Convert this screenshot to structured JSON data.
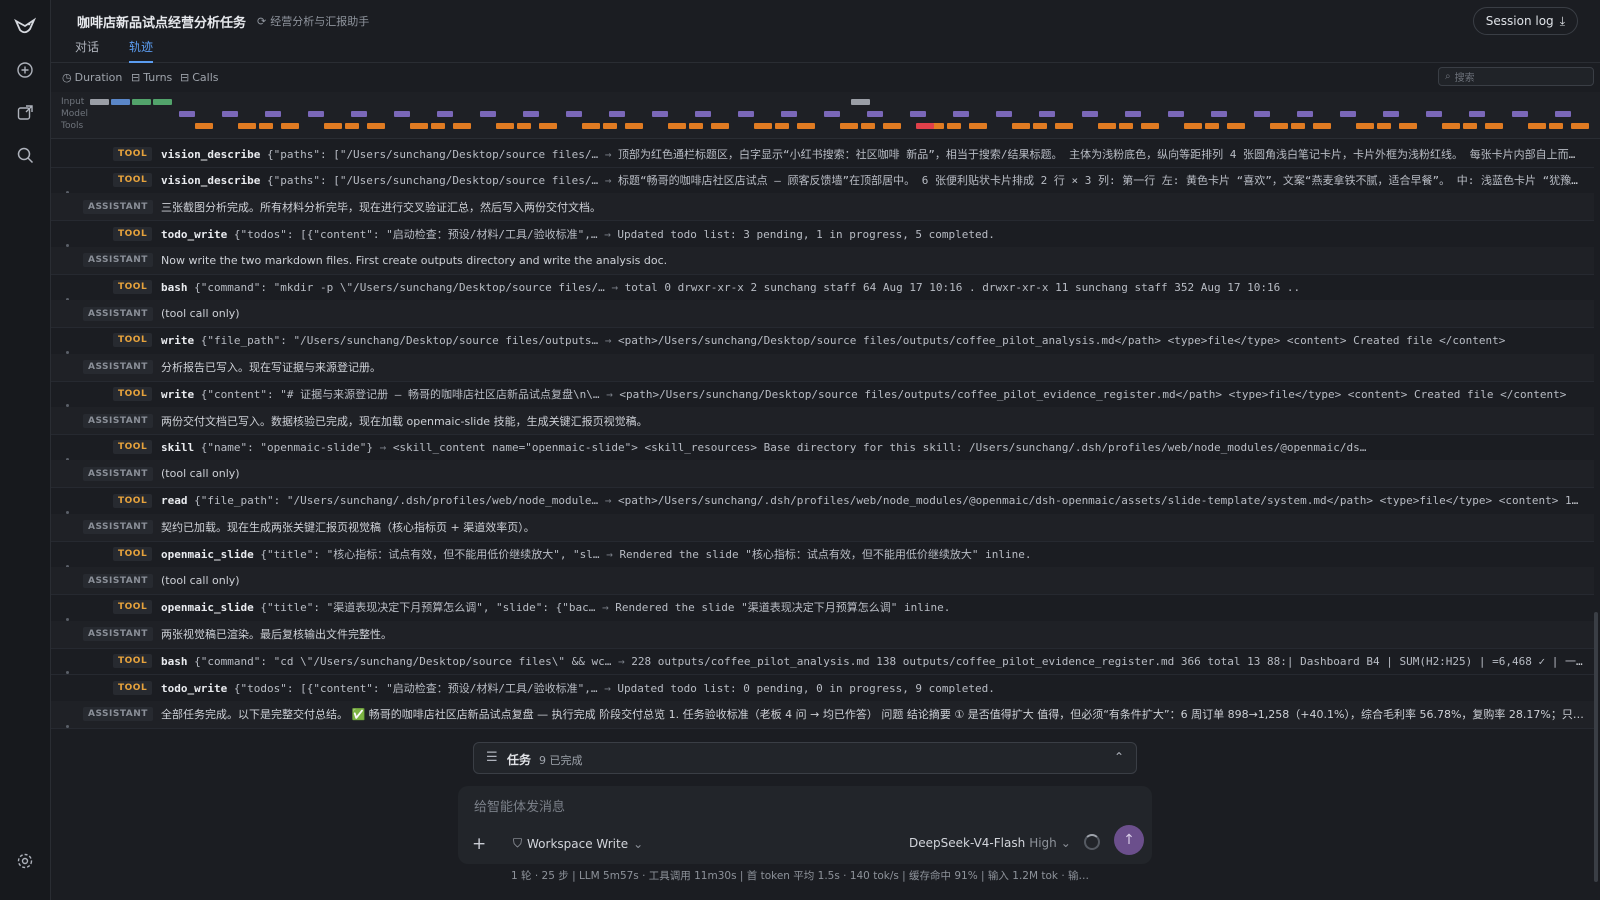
{
  "header": {
    "title": "咖啡店新品试点经营分析任务",
    "subtitle": "经营分析与汇报助手",
    "tabs": [
      {
        "label": "对话",
        "active": false
      },
      {
        "label": "轨迹",
        "active": true
      }
    ],
    "session_button": "Session log"
  },
  "filters": {
    "items": [
      "Duration",
      "Turns",
      "Calls"
    ],
    "search_placeholder": "搜索"
  },
  "timeline": {
    "labels": [
      "Input",
      "Model",
      "Tools"
    ],
    "colors": {
      "input_gray": "#9a9ea6",
      "input_blue": "#5a86c8",
      "input_green": "#52a36b",
      "model": "#7a67b8",
      "tool": "#e07b22",
      "tool_alert": "#e0404a"
    }
  },
  "rows": [
    {
      "kind": "TOOL",
      "tool": "vision_describe",
      "args": "{\"paths\": [\"/Users/sunchang/Desktop/source files/…",
      "result": "顶部为红色通栏标题区，白字显示“小红书搜索：社区咖啡 新品”，相当于搜索/结果标题。 主体为浅粉底色，纵向等距排列 4 张圆角浅白笔记卡片，卡片外框为浅粉红线。 每张卡片内部自上而下…"
    },
    {
      "kind": "TOOL",
      "tool": "vision_describe",
      "args": "{\"paths\": [\"/Users/sunchang/Desktop/source files/…",
      "result": "标题“畅哥的咖啡店社区店试点 – 顾客反馈墙”在顶部居中。 6 张便利贴状卡片排成 2 行 × 3 列: 第一行 左: 黄色卡片 “喜欢”，文案“燕麦拿铁不腻，适合早餐”。 中: 浅蓝色卡片 “犹豫”…"
    },
    {
      "kind": "ASSISTANT",
      "text": "三张截图分析完成。所有材料分析完毕，现在进行交叉验证汇总，然后写入两份交付文档。"
    },
    {
      "kind": "TOOL",
      "tool": "todo_write",
      "args": "{\"todos\": [{\"content\": \"启动检查：预设/材料/工具/验收标准\",…",
      "result": "Updated todo list: 3 pending, 1 in progress, 5 completed."
    },
    {
      "kind": "ASSISTANT",
      "text": "Now write the two markdown files. First create outputs directory and write the analysis doc."
    },
    {
      "kind": "TOOL",
      "tool": "bash",
      "args": "{\"command\": \"mkdir -p \\\"/Users/sunchang/Desktop/source files/…",
      "result": "total 0 drwxr-xr-x 2 sunchang staff 64 Aug 17 10:16 . drwxr-xr-x 11 sunchang staff 352 Aug 17 10:16 .."
    },
    {
      "kind": "ASSISTANT",
      "text": "(tool call only)"
    },
    {
      "kind": "TOOL",
      "tool": "write",
      "args": "{\"file_path\": \"/Users/sunchang/Desktop/source files/outputs…",
      "result": "<path>/Users/sunchang/Desktop/source files/outputs/coffee_pilot_analysis.md</path> <type>file</type> <content> Created file </content>"
    },
    {
      "kind": "ASSISTANT",
      "text": "分析报告已写入。现在写证据与来源登记册。"
    },
    {
      "kind": "TOOL",
      "tool": "write",
      "args": "{\"content\": \"# 证据与来源登记册 — 畅哥的咖啡店社区店新品试点复盘\\n\\…",
      "result": "<path>/Users/sunchang/Desktop/source files/outputs/coffee_pilot_evidence_register.md</path> <type>file</type> <content> Created file </content>"
    },
    {
      "kind": "ASSISTANT",
      "text": "两份交付文档已写入。数据核验已完成，现在加载 openmaic-slide 技能，生成关键汇报页视觉稿。"
    },
    {
      "kind": "TOOL",
      "tool": "skill",
      "args": "{\"name\": \"openmaic-slide\"}",
      "result": "<skill_content name=\"openmaic-slide\"> <skill_resources> Base directory for this skill: /Users/sunchang/.dsh/profiles/web/node_modules/@openmaic/ds…"
    },
    {
      "kind": "ASSISTANT",
      "text": "(tool call only)"
    },
    {
      "kind": "TOOL",
      "tool": "read",
      "args": "{\"file_path\": \"/Users/sunchang/.dsh/profiles/web/node_module…",
      "result": "<path>/Users/sunchang/.dsh/profiles/web/node_modules/@openmaic/dsh-openmaic/assets/slide-template/system.md</path> <type>file</type> <content> 1: …"
    },
    {
      "kind": "ASSISTANT",
      "text": "契约已加载。现在生成两张关键汇报页视觉稿（核心指标页 + 渠道效率页）。"
    },
    {
      "kind": "TOOL",
      "tool": "openmaic_slide",
      "args": "{\"title\": \"核心指标：试点有效，但不能用低价继续放大\", \"sl…",
      "result": "Rendered the slide \"核心指标：试点有效，但不能用低价继续放大\" inline."
    },
    {
      "kind": "ASSISTANT",
      "text": "(tool call only)"
    },
    {
      "kind": "TOOL",
      "tool": "openmaic_slide",
      "args": "{\"title\": \"渠道表现决定下月预算怎么调\", \"slide\": {\"bac…",
      "result": "Rendered the slide \"渠道表现决定下月预算怎么调\" inline."
    },
    {
      "kind": "ASSISTANT",
      "text": "两张视觉稿已渲染。最后复核输出文件完整性。"
    },
    {
      "kind": "TOOL",
      "tool": "bash",
      "args": "{\"command\": \"cd \\\"/Users/sunchang/Desktop/source files\\\" && wc…",
      "result": "228 outputs/coffee_pilot_analysis.md 138 outputs/coffee_pilot_evidence_register.md 366 total 13 88:| Dashboard B4 | SUM(H2:H25) | =6,468 ✓ | 一致 …"
    },
    {
      "kind": "TOOL",
      "tool": "todo_write",
      "args": "{\"todos\": [{\"content\": \"启动检查：预设/材料/工具/验收标准\",…",
      "result": "Updated todo list: 0 pending, 0 in progress, 9 completed."
    },
    {
      "kind": "ASSISTANT",
      "text": "全部任务完成。以下是完整交付总结。 ✅ 畅哥的咖啡店社区店新品试点复盘 — 执行完成 阶段交付总览 1. 任务验收标准（老板 4 问 → 均已作答） 问题 结论摘要 ① 是否值得扩大 值得，但必须“有条件扩大”：6 周订单 898→1,258（+40.1%），综合毛利率 56.78%，复购率 28.17%；只扩社区…"
    }
  ],
  "task_card": {
    "label": "任务",
    "count": "9 已完成"
  },
  "composer": {
    "placeholder": "给智能体发消息",
    "workspace": "Workspace Write",
    "model": "DeepSeek-V4-Flash",
    "effort": "High"
  },
  "status_bar": "1 轮 · 25 步  |  LLM 5m57s · 工具调用 11m30s  |  首 token 平均 1.5s · 140 tok/s  |  缓存命中 91%  |  输入 1.2M tok · 输…"
}
